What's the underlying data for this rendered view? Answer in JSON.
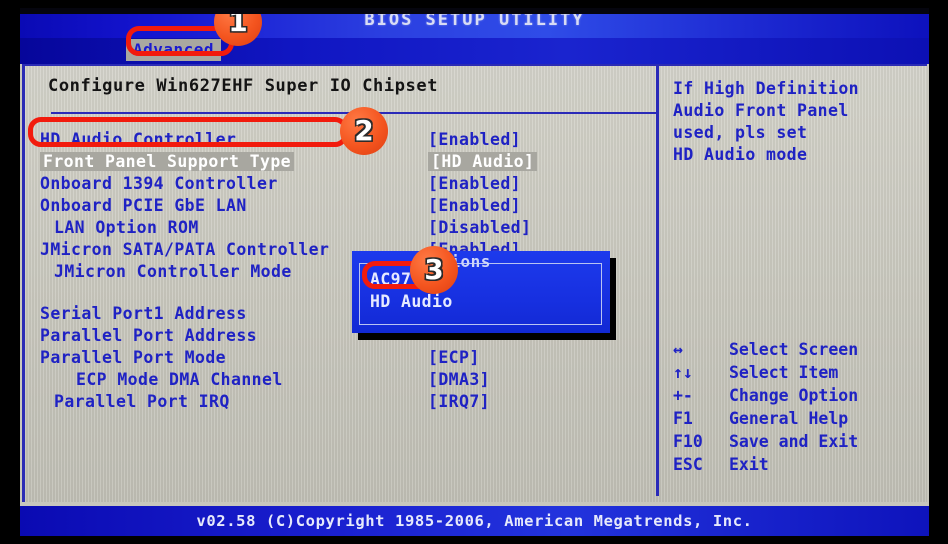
{
  "header": {
    "title": "BIOS SETUP UTILITY",
    "tabs": [
      {
        "label": "Advanced",
        "active": true
      }
    ]
  },
  "main": {
    "section_heading": "Configure Win627EHF Super IO Chipset",
    "rows": [
      {
        "label": "HD Audio Controller",
        "value": "[Enabled]",
        "indent": 0,
        "selected": false
      },
      {
        "label": "Front Panel Support Type",
        "value": "[HD Audio]",
        "indent": 0,
        "selected": true
      },
      {
        "label": "Onboard 1394 Controller",
        "value": "[Enabled]",
        "indent": 0,
        "selected": false
      },
      {
        "label": "Onboard PCIE GbE LAN",
        "value": "[Enabled]",
        "indent": 0,
        "selected": false
      },
      {
        "label": "LAN Option ROM",
        "value": "[Disabled]",
        "indent": 1,
        "selected": false
      },
      {
        "label": "JMicron SATA/PATA Controller",
        "value": "[Enabled]",
        "indent": 0,
        "selected": false
      },
      {
        "label": "JMicron Controller Mode",
        "value": "",
        "indent": 1,
        "selected": false
      },
      {
        "label": "Serial Port1 Address",
        "value": "",
        "indent": 0,
        "selected": false
      },
      {
        "label": "Parallel Port Address",
        "value": "",
        "indent": 0,
        "selected": false
      },
      {
        "label": "Parallel Port Mode",
        "value": "[ECP]",
        "indent": 0,
        "selected": false
      },
      {
        "label": "ECP Mode DMA Channel",
        "value": "[DMA3]",
        "indent": 2,
        "selected": false
      },
      {
        "label": "Parallel Port IRQ",
        "value": "[IRQ7]",
        "indent": 1,
        "selected": false
      }
    ]
  },
  "popup": {
    "title": "Options",
    "options": [
      {
        "label": "AC97",
        "highlighted": true
      },
      {
        "label": "HD Audio",
        "highlighted": false
      }
    ]
  },
  "help": {
    "lines": [
      "If High Definition",
      "Audio Front Panel",
      "used, pls set",
      "HD Audio mode"
    ]
  },
  "key_legend": [
    {
      "key": "↔",
      "desc": "Select Screen"
    },
    {
      "key": "↑↓",
      "desc": "Select Item"
    },
    {
      "key": "+-",
      "desc": "Change Option"
    },
    {
      "key": "F1",
      "desc": "General Help"
    },
    {
      "key": "F10",
      "desc": "Save and Exit"
    },
    {
      "key": "ESC",
      "desc": "Exit"
    }
  ],
  "footer": {
    "text": "v02.58 (C)Copyright 1985-2006, American Megatrends, Inc."
  },
  "annotations": {
    "badges": [
      {
        "number": "1",
        "target": "advanced-tab"
      },
      {
        "number": "2",
        "target": "front-panel-support-type-row"
      },
      {
        "number": "3",
        "target": "ac97-option"
      }
    ],
    "highlight_color": "#f21b0d",
    "badge_color": "#f4551f"
  }
}
